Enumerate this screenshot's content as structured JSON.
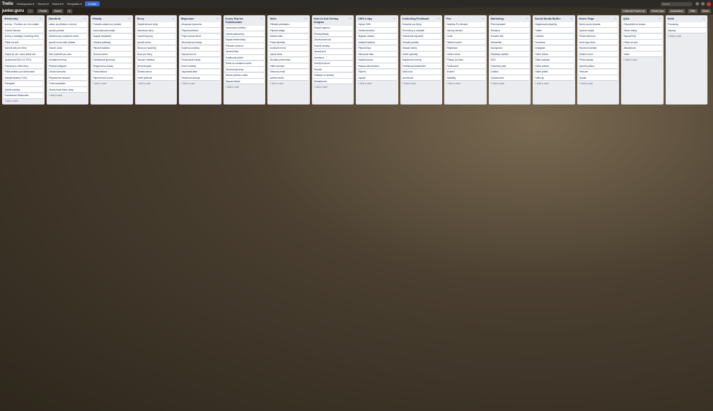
{
  "topbar": {
    "logo": "Trello",
    "menus": [
      "Workspaces ▾",
      "Recent ▾",
      "Starred ▾",
      "Templates ▾"
    ],
    "create": "Create",
    "search": "Search"
  },
  "board": {
    "name": "junior.guru",
    "chips": [
      "☆",
      "Private",
      "Board",
      "▾"
    ],
    "right": [
      "Calendar Power-Up",
      "Power-Ups",
      "Automation",
      "Filter",
      "Share"
    ]
  },
  "add_card": "+ Add a card",
  "lists": [
    {
      "title": "Weekendy",
      "cards": [
        "Inzerce - Pozítivní se k tím ostatní",
        "Oslovit Seznam",
        "Změny a strategie Coaching 2022",
        "Přidat na web",
        "Vytvořit web pro firmy",
        "Daylet se věc i stolu přidat info",
        "Vyzkoumat 2022-10 TOOL",
        "Podcast pro velké firmy",
        "Přidat stránku pro Weeknotes",
        "Vylepšit stránku TOOL",
        "Přemýšlet",
        "Vyřešit nabídku",
        "Kontaktovat Weeknotes"
      ]
    },
    {
      "title": "Zásobník",
      "cards": [
        "odkaz na průzkum o inzerci",
        "spustit podcast",
        "Udělat kurzy sociálních webů",
        "spustit novou web stránku",
        "Oslovit Jurka",
        "Sběr podnětů pro web",
        "Kontaktovat firmy",
        "Přepsat kategorie",
        "Oslovit komunitu",
        "Přepracovat oslovení",
        "Tvořit newsletter",
        "Zkontrolovat starší úkoly"
      ]
    },
    {
      "title": "Emaily",
      "cards": [
        "Požádat ostatní pro kontakt",
        "Automatizovat emaily",
        "Napsat newsletter",
        "Odeslat podklady",
        "Připravit šablonu",
        "Seznam adres",
        "Kontaktovat sponzory",
        "Reagovat na dotazy",
        "Poslat fakturu",
        "Připomenout termín"
      ]
    },
    {
      "title": "Slevy",
      "cards": [
        "Zlepšit slevové kódy",
        "Nabídnout slevu",
        "Vytvořit kupony",
        "Upravit ceník",
        "Sleva pro studenty",
        "Akce pro členy",
        "Vánoční nabídka",
        "Nová kampaň",
        "Členská sleva",
        "Ověřit platnost"
      ]
    },
    {
      "title": "Mapování",
      "cards": [
        "Zmapovat komunitu",
        "Připravit přehled",
        "Projít seznam firem",
        "Zkontrolovat odkazy",
        "Doplnit poznámky",
        "Sepsat shrnutí",
        "Prozkoumat zdroje",
        "Nové kontakty",
        "Uspořádat data",
        "Otestovat nástroje"
      ]
    },
    {
      "title": "Kurzy Stories Testimonials",
      "cards": [
        "Vyzvednout příběhy",
        "Oslovit absolventy",
        "Sepsat testimonialy",
        "Připravit rozhovor",
        "Upravit fotky",
        "Publikovat příběh",
        "Sdílet na sociálních sítích",
        "Zkontrolovat texty",
        "Sebrat zpětnou vazbu",
        "Napsat článek"
      ]
    },
    {
      "title": "Talks",
      "cards": [
        "Přihlásit přednášku",
        "Připravit slajdy",
        "Nahrát video",
        "Poslat abstrakt",
        "Domluvit termín",
        "Vybrat téma",
        "Zkouška prezentace",
        "Sdílet záznam",
        "Děkovný email",
        "Zpětná vazba"
      ]
    },
    {
      "title": "How to Ask Debug Chapter",
      "cards": [
        "Sepsat kapitolu",
        "Přidat příklady",
        "Zkontrolovat kód",
        "Doplnit obrázky",
        "Upravit text",
        "Korektura",
        "Zveřejnit návod",
        "Přeložit",
        "Odkázat ze stránky",
        "Aktualizovat"
      ]
    },
    {
      "title": "CMS a tipy",
      "cards": [
        "Vybrat CMS",
        "Otestovat editor",
        "Migrace obsahu",
        "Nastavit šablony",
        "Připravit tipy",
        "Zálohovat data",
        "Nastavit práva",
        "Napsat dokumentaci",
        "Školení",
        "Spustit"
      ]
    },
    {
      "title": "Collecting Feedback",
      "cards": [
        "Dotazník pro členy",
        "Rozhovory s uživateli",
        "Vyhodnotit odpovědi",
        "Seřadit podněty",
        "Sepsat závěry",
        "Sdílet výsledky",
        "Naplánovat změny",
        "Poděkovat účastníkům",
        "Další kolo",
        "Archivovat"
      ]
    },
    {
      "title": "Pro",
      "cards": [
        "Nabídka Pro členství",
        "Výhody členství",
        "Ceník",
        "Platební brána",
        "Registrace",
        "Uvítací email",
        "Přístup do klubu",
        "Prodloužení",
        "Zrušení",
        "Statistiky"
      ]
    },
    {
      "title": "Marketing",
      "cards": [
        "Plán kampaně",
        "Reklama",
        "Sociální sítě",
        "Newsletter",
        "Spolupráce",
        "Statistiky návštěv",
        "SEO",
        "Obsahový plán",
        "Grafika",
        "Vyhodnocení"
      ]
    },
    {
      "title": "Social Media Buffer",
      "cards": [
        "Naplánovat příspěvky",
        "Twitter",
        "LinkedIn",
        "Facebook",
        "Instagram",
        "Sdílet článek",
        "Sdílet podcast",
        "Sdílet událost",
        "Sdílet příběh",
        "Sdílet tip"
      ]
    },
    {
      "title": "Home Page",
      "cards": [
        "Nová úvodní stránka",
        "Upravit nadpis",
        "Přidat reference",
        "Nové logo firem",
        "Rychlost načítání",
        "Mobilní verze",
        "Přidat odkazy",
        "Upravit patičku",
        "Testovat",
        "Spustit"
      ]
    },
    {
      "title": "Q&A",
      "cards": [
        "Odpovědět na dotazy",
        "Sbírat otázky",
        "Sepsat FAQ",
        "Přidat na web",
        "Aktualizovat",
        "Sdílet"
      ]
    },
    {
      "title": "Další",
      "cards": [
        "Poznámky",
        "Nápady"
      ]
    }
  ],
  "colors": {
    "topbar": "#2c2a26",
    "list_bg": "#ebecf0",
    "button": "#3d6bd6"
  }
}
